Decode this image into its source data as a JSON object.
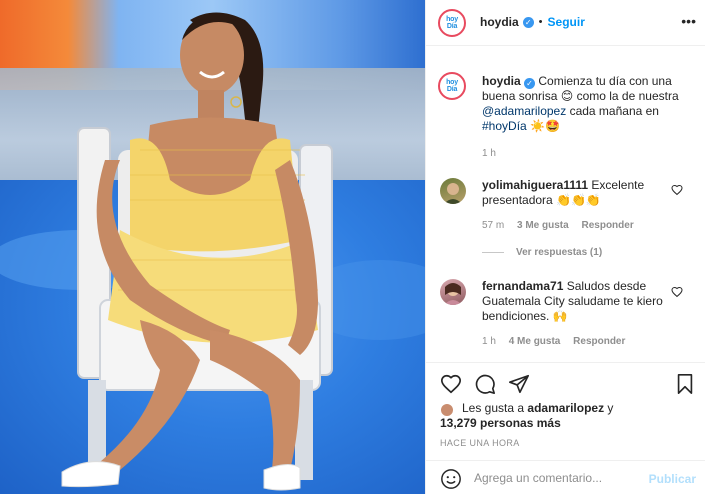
{
  "post": {
    "account": "hoydia",
    "logo_text_top": "hoy",
    "logo_text_bottom": "Día",
    "follow_label": "Seguir",
    "more_icon": "more-horizontal-icon"
  },
  "caption": {
    "username": "hoydia",
    "text_before": "Comienza tu día con una buena sonrisa 😊 como la de nuestra ",
    "mention": "@adamarilopez",
    "text_middle": " cada mañana en ",
    "hashtag": "#hoyDía",
    "text_after": " ☀️🤩",
    "time": "1 h"
  },
  "comments": [
    {
      "username": "yolimahiguera1111",
      "text": "Excelente presentadora 👏👏👏",
      "time": "57 m",
      "likes": "3 Me gusta",
      "reply_label": "Responder",
      "view_replies": "Ver respuestas (1)"
    },
    {
      "username": "fernandama71",
      "text": "Saludos desde Guatemala City saludame te kiero bendiciones. 🙌",
      "time": "1 h",
      "likes": "4 Me gusta",
      "reply_label": "Responder"
    }
  ],
  "likes": {
    "prefix": "Les gusta a ",
    "user": "adamarilopez",
    "middle": " y",
    "count": "13,279 personas más"
  },
  "timestamp": "HACE UNA HORA",
  "comment_box": {
    "placeholder": "Agrega un comentario...",
    "publish_label": "Publicar"
  },
  "colors": {
    "accent": "#0095f6",
    "verified": "#3897f0",
    "publish_disabled": "#b2dffc",
    "logo_ring": "#e84a5f",
    "logo_text": "#1f8fe0"
  }
}
